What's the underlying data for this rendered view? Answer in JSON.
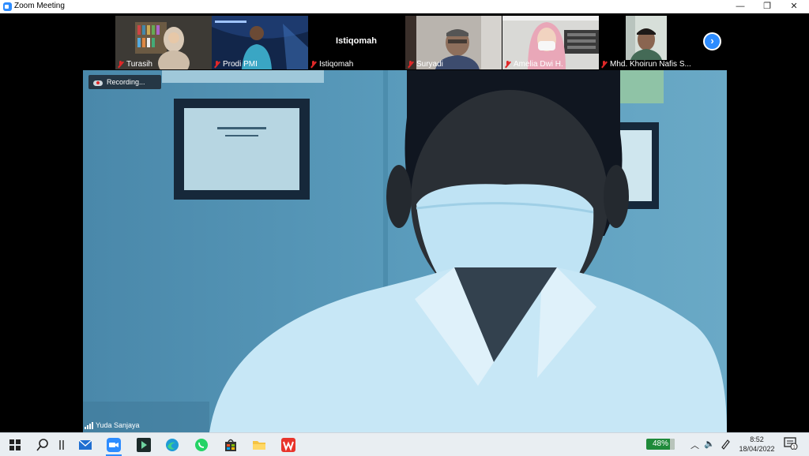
{
  "window": {
    "title": "Zoom Meeting",
    "controls": {
      "minimize": "—",
      "restore": "❐",
      "close": "✕"
    }
  },
  "participants_strip": {
    "tiles": [
      {
        "name": "Turasih",
        "muted": true
      },
      {
        "name": "Prodi PMI",
        "muted": true
      },
      {
        "name": "Istiqomah",
        "muted": true,
        "center_label": "Istiqomah"
      },
      {
        "name": "Suryadi",
        "muted": true
      },
      {
        "name": "Amelia Dwi H.",
        "muted": true
      },
      {
        "name": "Mhd. Khoirun Nafis S...",
        "muted": true
      }
    ],
    "next_button": "›"
  },
  "main_video": {
    "recording_label": "Recording...",
    "speaker_name": "Yuda Sanjaya"
  },
  "taskbar": {
    "battery": "48%",
    "time": "8:52",
    "date": "18/04/2022",
    "notification_count": "1"
  },
  "colors": {
    "zoom_blue": "#2d8cff",
    "muted_red": "#e02828",
    "taskbar_bg": "#e9eef2"
  }
}
